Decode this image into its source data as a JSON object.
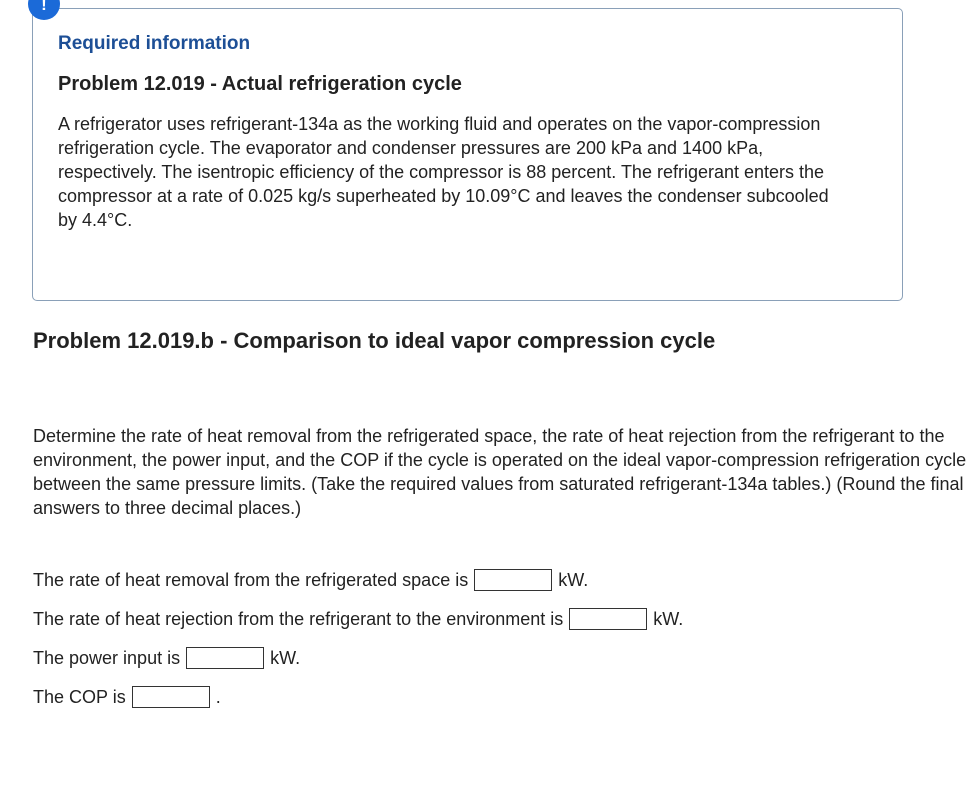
{
  "alert": {
    "icon": "exclamation-icon",
    "symbol": "!",
    "color": "#1b6ad8"
  },
  "info": {
    "heading": "Required information",
    "problem_title": "Problem 12.019 - Actual refrigeration cycle",
    "problem_text": "A refrigerator uses refrigerant-134a as the working fluid and operates on the vapor-compression refrigeration cycle. The evaporator and condenser pressures are 200 kPa and 1400 kPa, respectively. The isentropic efficiency of the compressor is 88 percent. The refrigerant enters the compressor at a rate of 0.025 kg/s superheated by 10.09°C and leaves the condenser subcooled by 4.4°C."
  },
  "part": {
    "title": "Problem 12.019.b - Comparison to ideal vapor compression cycle",
    "question": "Determine the rate of heat removal from the refrigerated space, the rate of heat rejection from the refrigerant to the environment, the power input, and the COP if the cycle is operated on the ideal vapor-compression refrigeration cycle between the same pressure limits. (Take the required values from saturated refrigerant-134a tables.) (Round the final answers to three decimal places.)"
  },
  "answers": [
    {
      "prefix": "The rate of heat removal from the refrigerated space is",
      "value": "",
      "suffix": "kW."
    },
    {
      "prefix": "The rate of heat rejection from the refrigerant to the environment is",
      "value": "",
      "suffix": "kW."
    },
    {
      "prefix": "The power input is",
      "value": "",
      "suffix": "kW."
    },
    {
      "prefix": "The COP is",
      "value": "",
      "suffix": "."
    }
  ]
}
